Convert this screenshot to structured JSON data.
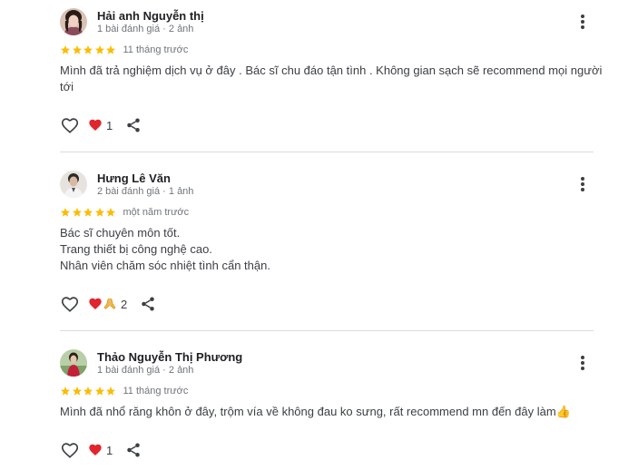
{
  "reviews": [
    {
      "name": "Hải anh Nguyễn thị",
      "meta": "1 bài đánh giá · 2 ảnh",
      "stars": 5,
      "date": "11 tháng trước",
      "text_lines": [
        "Mình đã trả nghiệm dịch vụ ở đây . Bác sĩ chu đáo tận tình . Không gian sạch sẽ recommend mọi người",
        "tới"
      ],
      "reactions": [
        "heart"
      ],
      "reaction_count": "1",
      "avatar_icon": "user-photo-icon"
    },
    {
      "name": "Hưng Lê Văn",
      "meta": "2 bài đánh giá · 1 ảnh",
      "stars": 5,
      "date": "một năm trước",
      "text_lines": [
        "Bác sĩ chuyên môn tốt.",
        "Trang thiết bị công nghệ cao.",
        "Nhân viên chăm sóc nhiệt tình cẩn thận."
      ],
      "reactions": [
        "heart",
        "pray"
      ],
      "reaction_count": "2",
      "avatar_icon": "user-photo-icon"
    },
    {
      "name": "Thảo Nguyễn Thị Phương",
      "meta": "1 bài đánh giá · 2 ảnh",
      "stars": 5,
      "date": "11 tháng trước",
      "text_lines": [
        "Mình đã nhổ răng khôn ở đây, trộm vía về không đau ko sưng, rất recommend mn đến đây làm👍"
      ],
      "reactions": [
        "heart"
      ],
      "reaction_count": "1",
      "avatar_icon": "user-photo-icon"
    }
  ],
  "colors": {
    "star": "#fbbc04",
    "heart": "#e2242c",
    "divider": "#dadce0",
    "meta": "#70757a"
  }
}
